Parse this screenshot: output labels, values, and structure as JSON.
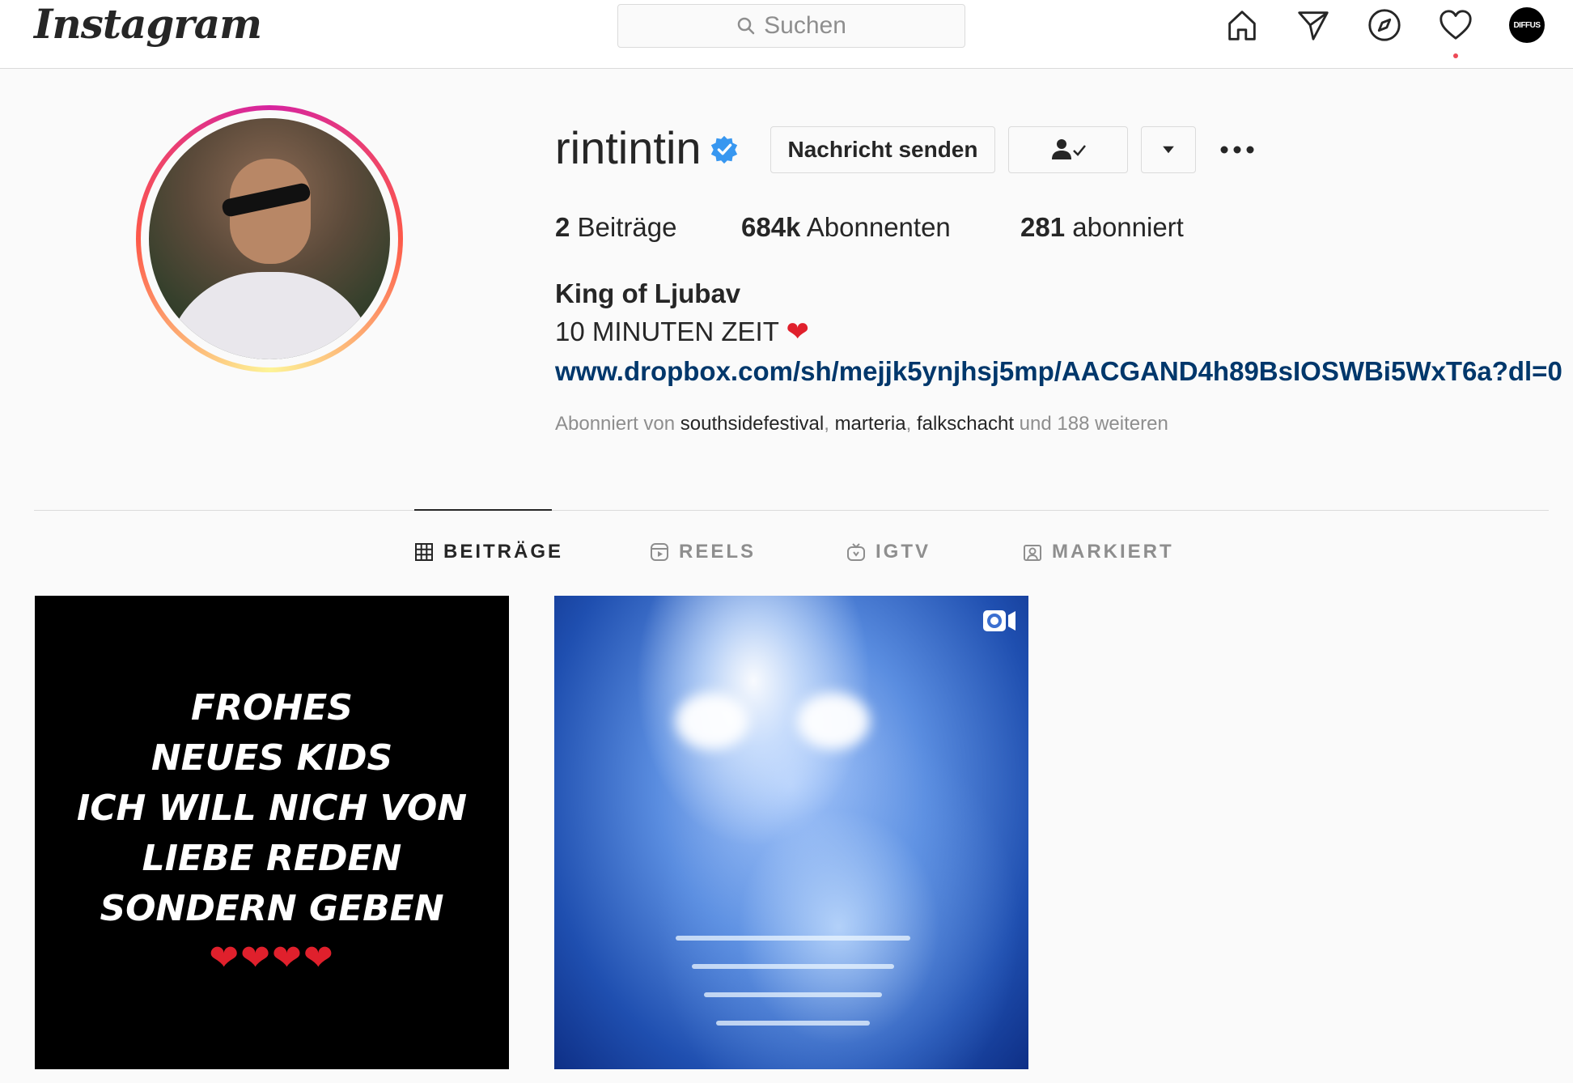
{
  "topbar": {
    "logo": "Instagram",
    "search_placeholder": "Suchen",
    "icons": [
      "home-icon",
      "direct-message-icon",
      "explore-icon",
      "activity-heart-icon"
    ],
    "avatar_label": "DIFFUS"
  },
  "profile": {
    "username": "rintintin",
    "verified": true,
    "buttons": {
      "message": "Nachricht senden",
      "following_icon": "person-check-icon",
      "dropdown_icon": "triangle-down-icon",
      "more_icon": "ellipsis-icon"
    },
    "stats": [
      {
        "value": "2",
        "label": "Beiträge"
      },
      {
        "value": "684k",
        "label": "Abonnenten"
      },
      {
        "value": "281",
        "label": "abonniert"
      }
    ],
    "full_name": "King of Ljubav",
    "bio_line": "10 MINUTEN ZEIT",
    "bio_emoji": "❤",
    "link": "www.dropbox.com/sh/mejjk5ynjhsj5mp/AACGAND4h89BsIOSWBi5WxT6a?dl=0",
    "followed_by": {
      "prefix": "Abonniert von",
      "accounts": [
        "southsidefestival",
        "marteria",
        "falkschacht"
      ],
      "suffix": "und 188 weiteren"
    }
  },
  "tabs": [
    {
      "label": "BEITRÄGE",
      "icon": "grid-icon",
      "active": true
    },
    {
      "label": "REELS",
      "icon": "reels-icon",
      "active": false
    },
    {
      "label": "IGTV",
      "icon": "igtv-icon",
      "active": false
    },
    {
      "label": "MARKIERT",
      "icon": "tagged-icon",
      "active": false
    }
  ],
  "posts": [
    {
      "type": "image",
      "text_lines": [
        "FROHES",
        "NEUES KIDS",
        "ICH WILL NICH VON",
        "LIEBE REDEN",
        "SONDERN GEBEN"
      ],
      "hearts": "❤❤❤❤"
    },
    {
      "type": "video",
      "icon": "video-icon"
    }
  ],
  "colors": {
    "background": "#fafafa",
    "link": "#00376b",
    "verified": "#3897f0",
    "notification": "#ed4956"
  }
}
